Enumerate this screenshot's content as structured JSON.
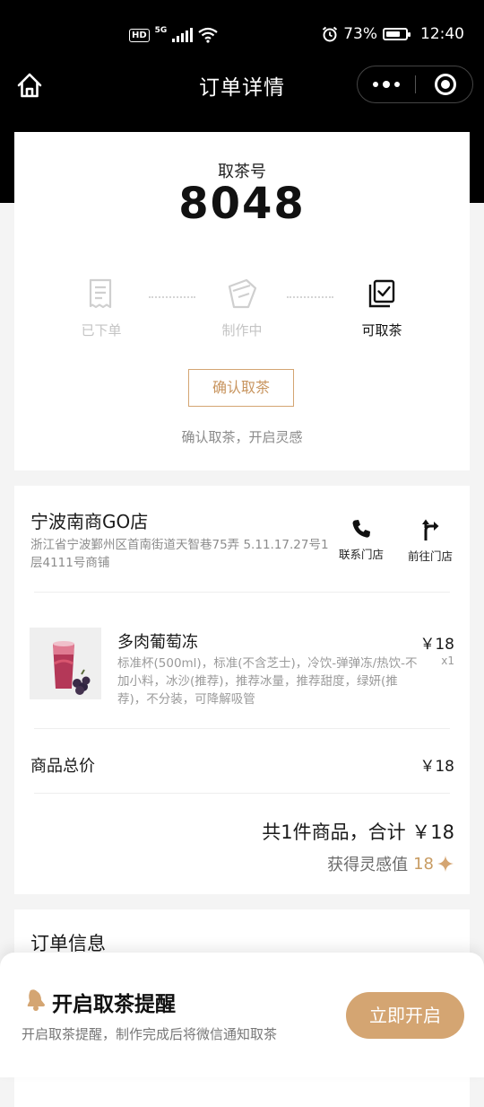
{
  "status_bar": {
    "hd": "HD",
    "network": "5G",
    "battery_percent": "73%",
    "battery_level": 0.73,
    "time": "12:40"
  },
  "nav": {
    "title": "订单详情",
    "home_icon": "home-icon",
    "more_icon": "more-dots-icon",
    "close_icon": "target-close-icon"
  },
  "pickup": {
    "label": "取茶号",
    "number": "8048"
  },
  "steps": [
    {
      "label": "已下单",
      "icon": "receipt-icon",
      "state": "done"
    },
    {
      "label": "制作中",
      "icon": "cup-making-icon",
      "state": "done"
    },
    {
      "label": "可取茶",
      "icon": "checkbox-icon",
      "state": "active"
    }
  ],
  "confirm": {
    "button": "确认取茶",
    "hint": "确认取茶，开启灵感"
  },
  "store": {
    "name": "宁波南商GO店",
    "address": "浙江省宁波鄞州区首南街道天智巷75弄 5.11.17.27号1层4111号商铺",
    "contact_label": "联系门店",
    "navigate_label": "前往门店"
  },
  "product": {
    "name": "多肉葡萄冻",
    "spec": "标准杯(500ml)，标准(不含芝士)，冷饮-弹弹冻/热饮-不加小料，冰沙(推荐)，推荐冰量，推荐甜度，绿妍(推荐)，不分装，可降解吸管",
    "price": "￥18",
    "qty": "x1"
  },
  "summary": {
    "subtotal_label": "商品总价",
    "subtotal_value": "￥18",
    "total_line": "共1件商品，合计 ￥18",
    "inspire_label": "获得灵感值",
    "inspire_points": "18"
  },
  "order_info": {
    "title": "订单信息"
  },
  "reminder": {
    "title": "开启取茶提醒",
    "desc": "开启取茶提醒，制作完成后将微信通知取茶",
    "button": "立即开启"
  },
  "colors": {
    "accent": "#d4a572",
    "header_bg": "#000000",
    "page_bg": "#f4f4f4"
  }
}
